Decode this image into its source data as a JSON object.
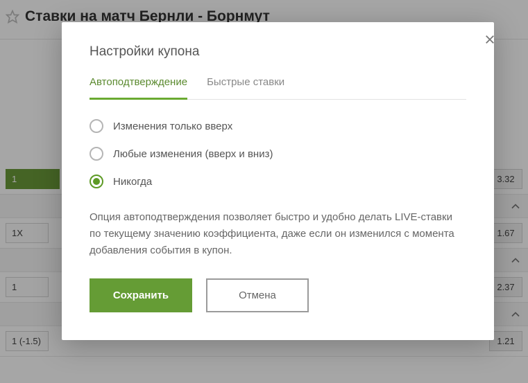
{
  "bg": {
    "title": "Ставки на матч Бернли - Борнмут",
    "rows": [
      {
        "label": "1",
        "odd": "3.32",
        "green": true
      },
      {
        "label": "1X",
        "odd": "1.67",
        "green": false
      },
      {
        "label": "1",
        "odd": "2.37",
        "green": false
      },
      {
        "label": "1 (-1.5)",
        "odd": "1.21",
        "green": false
      }
    ]
  },
  "modal": {
    "title": "Настройки купона",
    "tabs": {
      "auto": "Автоподтверждение",
      "quick": "Быстрые ставки"
    },
    "options": {
      "up": "Изменения только вверх",
      "any": "Любые изменения (вверх и вниз)",
      "never": "Никогда"
    },
    "description": "Опция автоподтверждения позволяет быстро и удобно делать LIVE-ставки по текущему значению коэффициента, даже если он изменился с момента добавления события в купон.",
    "save": "Сохранить",
    "cancel": "Отмена"
  }
}
